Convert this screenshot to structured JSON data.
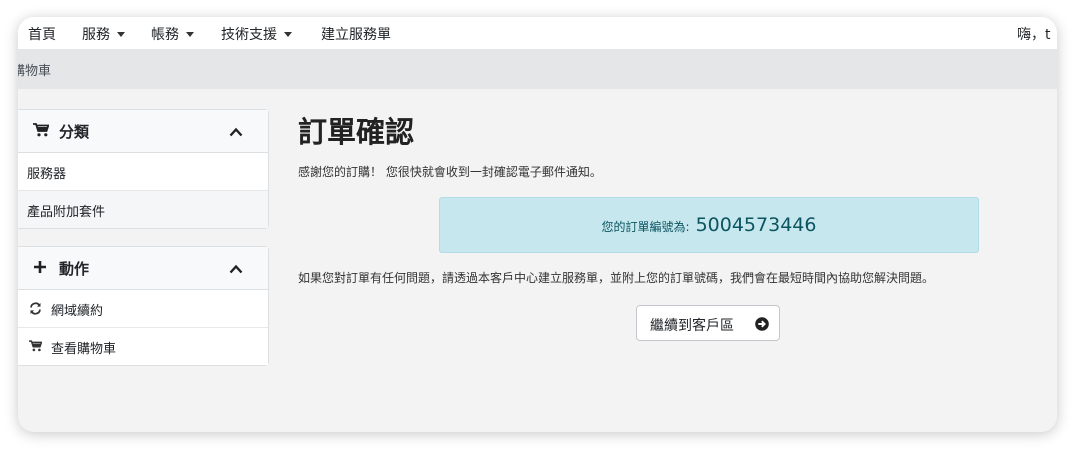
{
  "nav": {
    "items": [
      {
        "label": "首頁",
        "dropdown": false
      },
      {
        "label": "服務",
        "dropdown": true
      },
      {
        "label": "帳務",
        "dropdown": true
      },
      {
        "label": "技術支援",
        "dropdown": true
      },
      {
        "label": "建立服務單",
        "dropdown": false
      }
    ],
    "greeting": "嗨，t"
  },
  "breadcrumb": "購物車",
  "sidebar": {
    "categories": {
      "title": "分類",
      "icon": "cart-icon",
      "items": [
        "服務器",
        "產品附加套件"
      ]
    },
    "actions": {
      "title": "動作",
      "icon": "plus-icon",
      "items": [
        {
          "label": "網域續約",
          "icon": "refresh-icon"
        },
        {
          "label": "查看購物車",
          "icon": "cart-icon"
        }
      ]
    }
  },
  "main": {
    "title": "訂單確認",
    "thanks": "感謝您的訂購！ 您很快就會收到一封確認電子郵件通知。",
    "order_label": "您的訂單編號為:",
    "order_number": "5004573446",
    "help": "如果您對訂單有任何問題，請透過本客戶中心建立服務單，並附上您的訂單號碼，我們會在最短時間內協助您解決問題。",
    "continue_label": "繼續到客戶區"
  }
}
